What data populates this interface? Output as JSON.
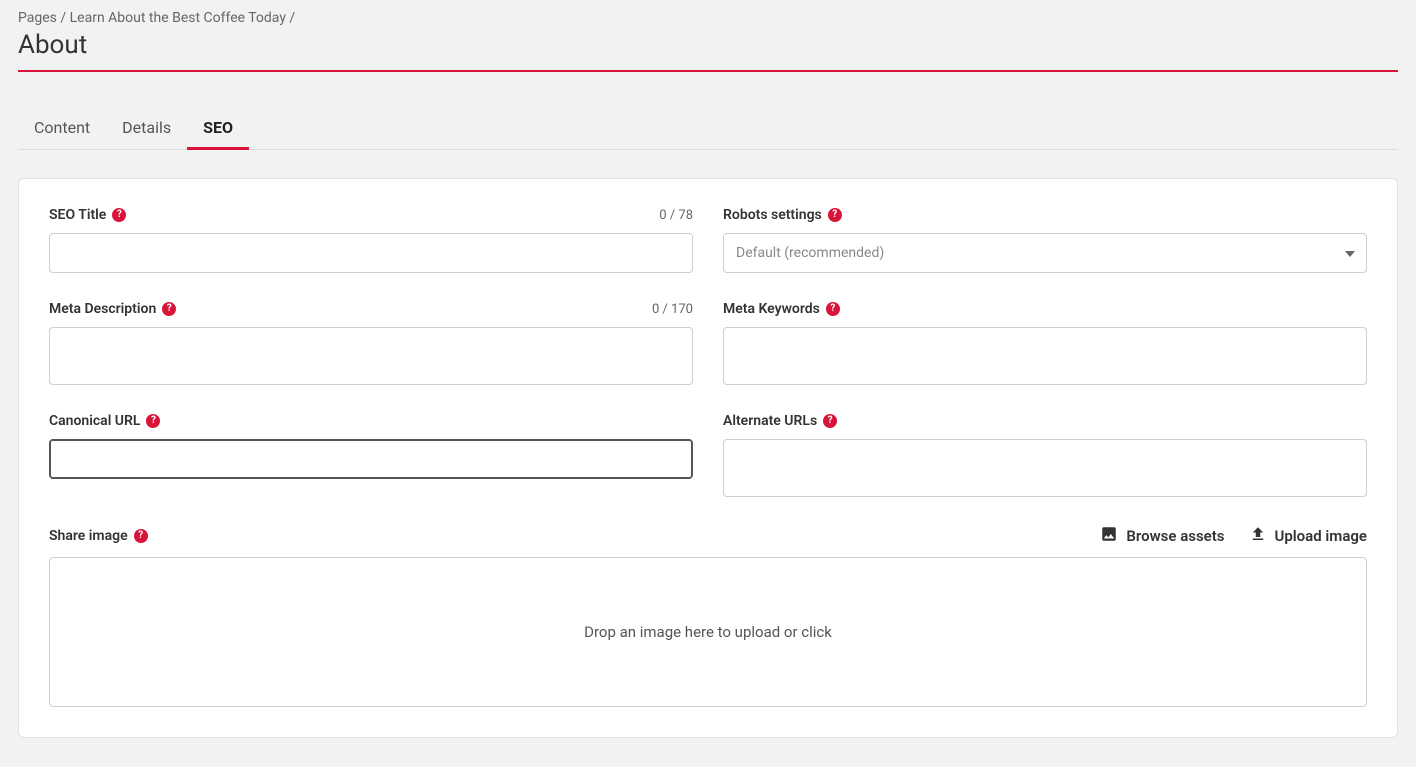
{
  "breadcrumb": {
    "root": "Pages",
    "parent": "Learn About the Best Coffee Today",
    "separator": "/"
  },
  "page_title": "About",
  "tabs": {
    "content": "Content",
    "details": "Details",
    "seo": "SEO"
  },
  "fields": {
    "seo_title": {
      "label": "SEO Title",
      "counter": "0 / 78",
      "value": ""
    },
    "robots": {
      "label": "Robots settings",
      "selected": "Default (recommended)"
    },
    "meta_description": {
      "label": "Meta Description",
      "counter": "0 / 170",
      "value": ""
    },
    "meta_keywords": {
      "label": "Meta Keywords",
      "value": ""
    },
    "canonical_url": {
      "label": "Canonical URL",
      "value": ""
    },
    "alternate_urls": {
      "label": "Alternate URLs",
      "value": ""
    },
    "share_image": {
      "label": "Share image",
      "browse_label": "Browse assets",
      "upload_label": "Upload image",
      "dropzone_text": "Drop an image here to upload or click"
    }
  },
  "help_glyph": "?"
}
